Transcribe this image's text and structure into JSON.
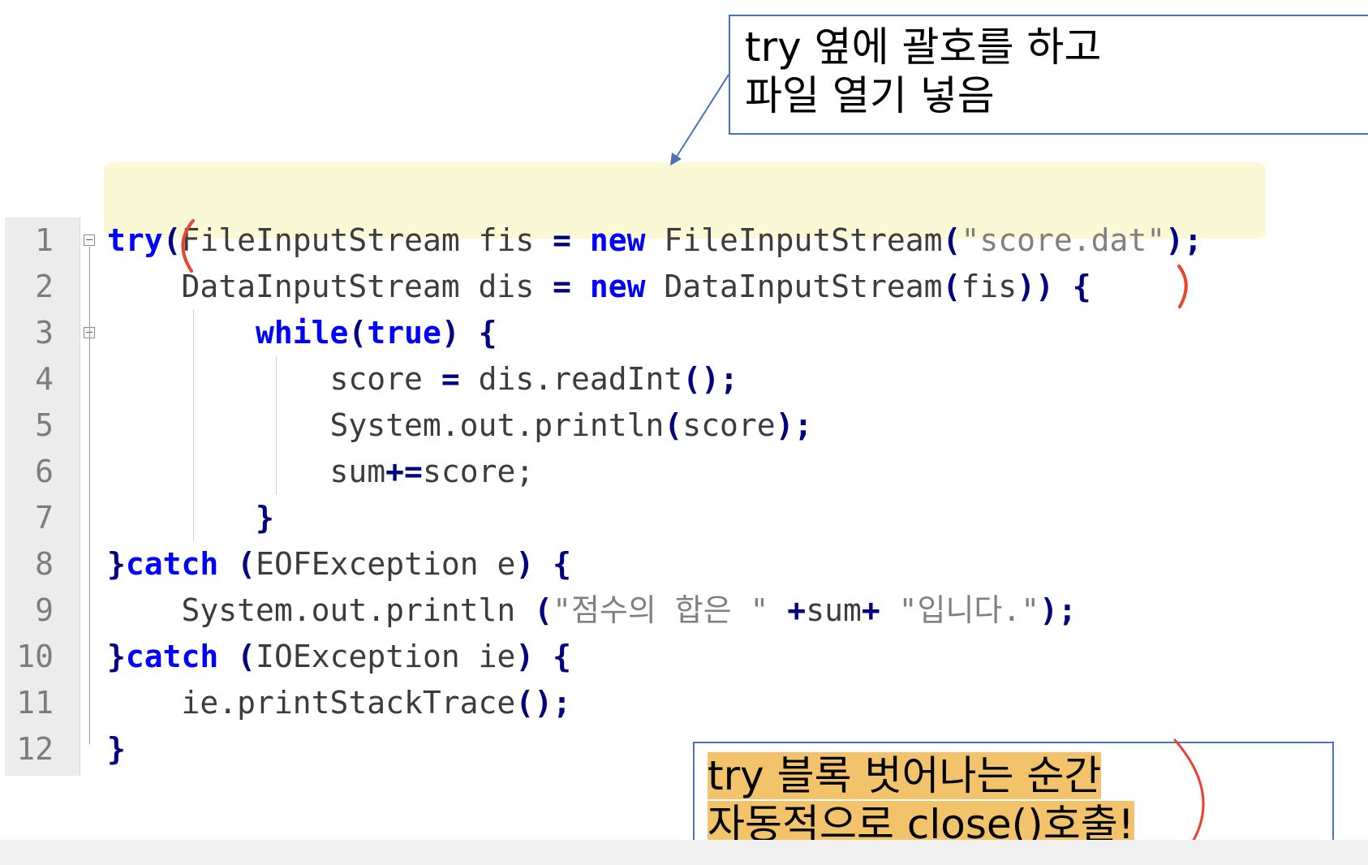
{
  "callouts": {
    "top": {
      "line1": "try 옆에 괄호를 하고",
      "line2": "파일 열기 넣음"
    },
    "bottom": {
      "line1": "try 블록 벗어나는 순간",
      "line2": "자동적으로 close()호출!"
    }
  },
  "editor": {
    "line_numbers": [
      "1",
      "2",
      "3",
      "4",
      "5",
      "6",
      "7",
      "8",
      "9",
      "10",
      "11",
      "12"
    ],
    "lines": [
      [
        {
          "t": "try",
          "c": "kw"
        },
        {
          "t": "(",
          "c": "op"
        },
        {
          "t": "FileInputStream fis ",
          "c": "tx"
        },
        {
          "t": "=",
          "c": "op"
        },
        {
          "t": " ",
          "c": "tx"
        },
        {
          "t": "new",
          "c": "kw"
        },
        {
          "t": " FileInputStream",
          "c": "tx"
        },
        {
          "t": "(",
          "c": "op"
        },
        {
          "t": "\"score.dat\"",
          "c": "str"
        },
        {
          "t": ");",
          "c": "op"
        }
      ],
      [
        {
          "t": "    DataInputStream dis ",
          "c": "tx"
        },
        {
          "t": "=",
          "c": "op"
        },
        {
          "t": " ",
          "c": "tx"
        },
        {
          "t": "new",
          "c": "kw"
        },
        {
          "t": " DataInputStream",
          "c": "tx"
        },
        {
          "t": "(",
          "c": "op"
        },
        {
          "t": "fis",
          "c": "tx"
        },
        {
          "t": "))",
          "c": "op"
        },
        {
          "t": " ",
          "c": "tx"
        },
        {
          "t": "{",
          "c": "op"
        }
      ],
      [
        {
          "t": "        ",
          "c": "tx"
        },
        {
          "t": "while",
          "c": "kw"
        },
        {
          "t": "(",
          "c": "op"
        },
        {
          "t": "true",
          "c": "kw"
        },
        {
          "t": ")",
          "c": "op"
        },
        {
          "t": " ",
          "c": "tx"
        },
        {
          "t": "{",
          "c": "op"
        }
      ],
      [
        {
          "t": "            score ",
          "c": "tx"
        },
        {
          "t": "=",
          "c": "op"
        },
        {
          "t": " dis.readInt",
          "c": "tx"
        },
        {
          "t": "();",
          "c": "op"
        }
      ],
      [
        {
          "t": "            System.out.println",
          "c": "tx"
        },
        {
          "t": "(",
          "c": "op"
        },
        {
          "t": "score",
          "c": "tx"
        },
        {
          "t": ");",
          "c": "op"
        }
      ],
      [
        {
          "t": "            sum",
          "c": "tx"
        },
        {
          "t": "+=",
          "c": "op"
        },
        {
          "t": "score;",
          "c": "tx"
        }
      ],
      [
        {
          "t": "        ",
          "c": "tx"
        },
        {
          "t": "}",
          "c": "op"
        }
      ],
      [
        {
          "t": "}",
          "c": "op"
        },
        {
          "t": "catch",
          "c": "kw"
        },
        {
          "t": " ",
          "c": "tx"
        },
        {
          "t": "(",
          "c": "op"
        },
        {
          "t": "EOFException e",
          "c": "tx"
        },
        {
          "t": ")",
          "c": "op"
        },
        {
          "t": " ",
          "c": "tx"
        },
        {
          "t": "{",
          "c": "op"
        }
      ],
      [
        {
          "t": "    System.out.println ",
          "c": "tx"
        },
        {
          "t": "(",
          "c": "op"
        },
        {
          "t": "\"점수의 합은 \"",
          "c": "str"
        },
        {
          "t": " ",
          "c": "tx"
        },
        {
          "t": "+",
          "c": "op"
        },
        {
          "t": "sum",
          "c": "tx"
        },
        {
          "t": "+",
          "c": "op"
        },
        {
          "t": " ",
          "c": "tx"
        },
        {
          "t": "\"입니다.\"",
          "c": "str"
        },
        {
          "t": ");",
          "c": "op"
        }
      ],
      [
        {
          "t": "}",
          "c": "op"
        },
        {
          "t": "catch",
          "c": "kw"
        },
        {
          "t": " ",
          "c": "tx"
        },
        {
          "t": "(",
          "c": "op"
        },
        {
          "t": "IOException ie",
          "c": "tx"
        },
        {
          "t": ")",
          "c": "op"
        },
        {
          "t": " ",
          "c": "tx"
        },
        {
          "t": "{",
          "c": "op"
        }
      ],
      [
        {
          "t": "    ie.printStackTrace",
          "c": "tx"
        },
        {
          "t": "();",
          "c": "op"
        }
      ],
      [
        {
          "t": "}",
          "c": "op"
        }
      ]
    ]
  },
  "colors": {
    "keyword": "#0000ff",
    "operator": "#000080",
    "string": "#808080",
    "annotation_red": "#e8442e",
    "callout_border": "#4a72b8",
    "highlight": "#f2c36b"
  }
}
